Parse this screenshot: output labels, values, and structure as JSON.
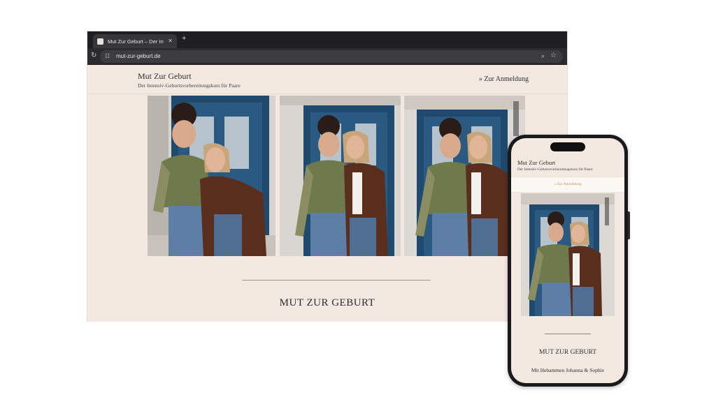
{
  "browser": {
    "tab_title": "Mut Zur Geburt – Der Intensiv…",
    "new_tab_label": "+",
    "close_label": "✕",
    "url": "mut-zur-geburt.de"
  },
  "site": {
    "brand_title": "Mut Zur Geburt",
    "brand_subtitle": "Der Intensiv-Geburtsvorbereitungskurs für Paare",
    "nav_link": "» Zur Anmeldung",
    "hero_title": "MUT ZUR GEBURT"
  },
  "mobile": {
    "brand_title": "Mut Zur Geburt",
    "brand_subtitle": "Der Intensiv-Geburtsvorbereitungskurs für Paare",
    "nav_link": "» Zur Anmeldung",
    "hero_title": "MUT ZUR GEBURT",
    "subtitle": "Mit Hebammen Johanna & Sophie"
  },
  "icons": [
    "reload-icon",
    "site-info-icon",
    "zoom-icon",
    "bookmark-star-icon",
    "close-icon"
  ],
  "colors": {
    "page_background": "#f3e9e1",
    "door_blue": "#1f4a6e",
    "accent_link": "#c98a5f"
  }
}
